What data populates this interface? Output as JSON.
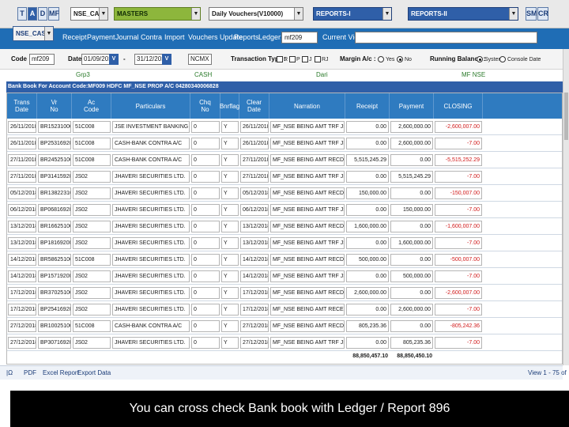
{
  "topbar": {
    "buttons": [
      "T",
      "A",
      "D",
      "MF"
    ],
    "segment_select": "NSE_CASH",
    "masters_select": "MASTERS",
    "vouchers_select": "Daily Vouchers(V10000)",
    "reports1_select": "REPORTS-I",
    "reports2_select": "REPORTS-II",
    "right_buttons": [
      "SM",
      "CR"
    ]
  },
  "menubar": {
    "segment_select": "NSE_CASH",
    "items": [
      "Receipt",
      "Payment",
      "Journal",
      "Contra",
      "Import",
      "Vouchers Update",
      "Reports",
      "Ledger:"
    ],
    "ledger_value": "mf209",
    "current_view_label": "Current View:",
    "current_view_value": ""
  },
  "filter": {
    "code_label": "Code :",
    "code_value": "mf209",
    "date_label": "Date :",
    "date_from": "01/09/2018",
    "date_sep": "-",
    "date_to": "31/12/2018",
    "v_button": "V",
    "exchange_value": "NCMX",
    "transaction_type_label": "Transaction Type :",
    "transaction_types": [
      "R",
      "P",
      "J",
      "RJ"
    ],
    "margin_label": "Margin A/c :",
    "margin_options": [
      "Yes",
      "No"
    ],
    "margin_selected": "No",
    "running_balance_label": "Running Balance :",
    "running_options": [
      "System",
      "Console Date"
    ],
    "running_selected": "System"
  },
  "groups": [
    "Grp3",
    "CASH",
    "Dari",
    "MF NSE"
  ],
  "caption": "Bank Book For Account Code:MF009 HDFC MF_NSE PROP A/C 04280340006828",
  "columns": [
    "Trans\nDate",
    "Vr\nNo",
    "Ac\nCode",
    "Particulars",
    "Chq\nNo",
    "Bnrflag",
    "Clear\nDate",
    "Narration",
    "Receipt",
    "Payment",
    "CLOSING"
  ],
  "rows": [
    [
      "26/11/2018",
      "BR1523100009",
      "51C008",
      "JSE INVESTMENT BANKING LTD.",
      "0",
      "Y",
      "26/11/2018",
      "MF_NSE BEING AMT TRF JSL ISE",
      "0.00",
      "2,600,000.00",
      "-2,600,007.00"
    ],
    [
      "26/11/2018",
      "BP253169200",
      "51C008",
      "CASH-BANK CONTRA A/C",
      "0",
      "Y",
      "26/11/2018",
      "MF_NSE BEING AMT TRF JSL ISE",
      "0.00",
      "2,600,000.00",
      "-7.00"
    ],
    [
      "27/11/2018",
      "BR245251002",
      "51C008",
      "CASH-BANK CONTRA A/C",
      "0",
      "Y",
      "27/11/2018",
      "MF_NSE BEING AMT RECD OF JS",
      "5,515,245.29",
      "0.00",
      "-5,515,252.29"
    ],
    [
      "27/11/2018",
      "BP314159200",
      "JS02",
      "JHAVERI SECURITIES LTD.",
      "0",
      "Y",
      "27/11/2018",
      "MF_NSE BEING AMT TRF JSL IS I",
      "0.00",
      "5,515,245.29",
      "-7.00"
    ],
    [
      "05/12/2018",
      "BR138223100",
      "JS02",
      "JHAVERI SECURITIES LTD.",
      "0",
      "Y",
      "05/12/2018",
      "MF_NSE BEING AMT RECD OF JS",
      "150,000.00",
      "0.00",
      "-150,007.00"
    ],
    [
      "06/12/2018",
      "BP068169200",
      "JS02",
      "JHAVERI SECURITIES LTD.",
      "0",
      "Y",
      "06/12/2018",
      "MF_NSE BEING AMT TRF JSL NSE",
      "0.00",
      "150,000.00",
      "-7.00"
    ],
    [
      "13/12/2018",
      "BR166251002",
      "JS02",
      "JHAVERI SECURITIES LTD.",
      "0",
      "Y",
      "13/12/2018",
      "MF_NSE BEING AMT RECD OF JS",
      "1,600,000.00",
      "0.00",
      "-1,600,007.00"
    ],
    [
      "13/12/2018",
      "BP181692000",
      "JS02",
      "JHAVERI SECURITIES LTD.",
      "0",
      "Y",
      "13/12/2018",
      "MF_NSE BEING AMT TRF JSL NSE",
      "0.00",
      "1,600,000.00",
      "-7.00"
    ],
    [
      "14/12/2018",
      "BR586251002",
      "51C008",
      "JHAVERI SECURITIES LTD.",
      "0",
      "Y",
      "14/12/2018",
      "MF_NSE BEING AMT RECD OF JS",
      "500,000.00",
      "0.00",
      "-500,007.00"
    ],
    [
      "14/12/2018",
      "BP157192000",
      "JS02",
      "JHAVERI SECURITIES LTD.",
      "0",
      "Y",
      "14/12/2018",
      "MF_NSE BEING AMT TRF JSL NSE",
      "0.00",
      "500,000.00",
      "-7.00"
    ],
    [
      "17/12/2018",
      "BR370251002",
      "JS02",
      "JHAVERI SECURITIES LTD.",
      "0",
      "Y",
      "17/12/2018",
      "MF_NSE BEING AMT RECD OF JS",
      "2,600,000.00",
      "0.00",
      "-2,600,007.00"
    ],
    [
      "17/12/2018",
      "BP254169200",
      "JS02",
      "JHAVERI SECURITIES LTD.",
      "0",
      "Y",
      "17/12/2018",
      "MF_NSE BEING AMT RECE JSL NI",
      "0.00",
      "2,600,000.00",
      "-7.00"
    ],
    [
      "27/12/2018",
      "BR100251002",
      "51C008",
      "CASH-BANK CONTRA A/C",
      "0",
      "Y",
      "27/12/2018",
      "MF_NSE BEING AMT RECD OF JS",
      "805,235.36",
      "0.00",
      "-805,242.36"
    ],
    [
      "27/12/2018",
      "BP307169200",
      "JS02",
      "JHAVERI SECURITIES LTD.",
      "0",
      "Y",
      "27/12/2018",
      "MF_NSE BEING AMT TRF JSL IS I",
      "0.00",
      "805,235.36",
      "-7.00"
    ]
  ],
  "totals": {
    "receipt": "88,850,457.10",
    "payment": "88,850,450.10"
  },
  "footer": {
    "items": [
      "PDF",
      "Excel Report",
      "Export Data"
    ],
    "lead": "|Ω",
    "view_count": "View 1 - 75 of"
  },
  "slide_caption": "You can cross check Bank book with Ledger / Report 896"
}
